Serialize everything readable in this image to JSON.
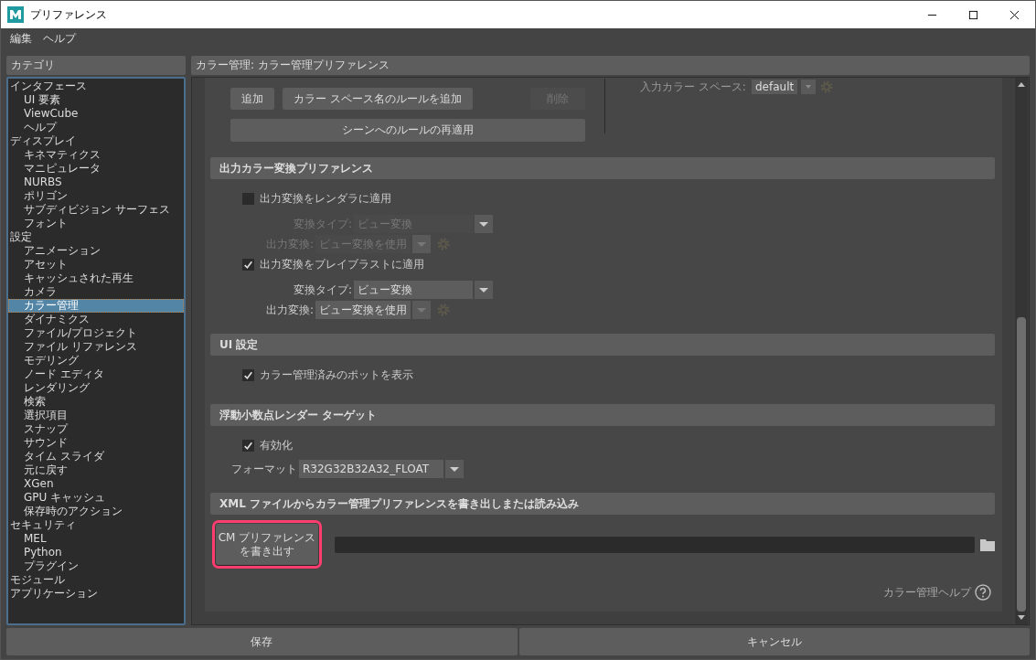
{
  "window": {
    "title": "プリファレンス"
  },
  "menu": [
    "編集",
    "ヘルプ"
  ],
  "categories": {
    "header": "カテゴリ",
    "items": [
      {
        "label": "インタフェース",
        "selected": false,
        "children": [
          {
            "label": "UI 要素",
            "selected": false
          },
          {
            "label": "ViewCube",
            "selected": false
          },
          {
            "label": "ヘルプ",
            "selected": false
          }
        ]
      },
      {
        "label": "ディスプレイ",
        "selected": false,
        "children": [
          {
            "label": "キネマティクス",
            "selected": false
          },
          {
            "label": "マニピュレータ",
            "selected": false
          },
          {
            "label": "NURBS",
            "selected": false
          },
          {
            "label": "ポリゴン",
            "selected": false
          },
          {
            "label": "サブディビジョン サーフェス",
            "selected": false
          },
          {
            "label": "フォント",
            "selected": false
          }
        ]
      },
      {
        "label": "設定",
        "selected": false,
        "children": [
          {
            "label": "アニメーション",
            "selected": false
          },
          {
            "label": "アセット",
            "selected": false
          },
          {
            "label": "キャッシュされた再生",
            "selected": false
          },
          {
            "label": "カメラ",
            "selected": false
          },
          {
            "label": "カラー管理",
            "selected": true
          },
          {
            "label": "ダイナミクス",
            "selected": false
          },
          {
            "label": "ファイル/プロジェクト",
            "selected": false
          },
          {
            "label": "ファイル リファレンス",
            "selected": false
          },
          {
            "label": "モデリング",
            "selected": false
          },
          {
            "label": "ノード エディタ",
            "selected": false
          },
          {
            "label": "レンダリング",
            "selected": false
          },
          {
            "label": "検索",
            "selected": false
          },
          {
            "label": "選択項目",
            "selected": false
          },
          {
            "label": "スナップ",
            "selected": false
          },
          {
            "label": "サウンド",
            "selected": false
          },
          {
            "label": "タイム スライダ",
            "selected": false
          },
          {
            "label": "元に戻す",
            "selected": false
          },
          {
            "label": "XGen",
            "selected": false
          },
          {
            "label": "GPU キャッシュ",
            "selected": false
          },
          {
            "label": "保存時のアクション",
            "selected": false
          }
        ]
      },
      {
        "label": "セキュリティ",
        "selected": false,
        "children": [
          {
            "label": "MEL",
            "selected": false
          },
          {
            "label": "Python",
            "selected": false
          },
          {
            "label": "プラグイン",
            "selected": false
          }
        ]
      },
      {
        "label": "モジュール",
        "selected": false
      },
      {
        "label": "アプリケーション",
        "selected": false
      }
    ]
  },
  "panel": {
    "header": "カラー管理: カラー管理プリファレンス",
    "rules": {
      "buttons": [
        {
          "label": "追加",
          "disabled": false
        },
        {
          "label": "カラー スペース名のルールを追加",
          "disabled": false
        },
        {
          "label": "削除",
          "disabled": true
        }
      ],
      "reapply": "シーンへのルールの再適用",
      "input_space": {
        "label": "入力カラー スペース:",
        "value": "default",
        "disabled": true
      }
    },
    "sections": [
      {
        "title": "出力カラー変換プリファレンス",
        "rows": [
          {
            "kind": "checkbox",
            "label": "出力変換をレンダラに適用",
            "checked": false
          },
          {
            "kind": "dropdown",
            "label": "変換タイプ:",
            "value": "ビュー変換",
            "disabled": true,
            "gear": false
          },
          {
            "kind": "dropdown",
            "label": "出力変換:",
            "value": "ビュー変換を使用",
            "disabled": true,
            "gear": true
          },
          {
            "kind": "checkbox",
            "label": "出力変換をプレイブラストに適用",
            "checked": true
          },
          {
            "kind": "dropdown",
            "label": "変換タイプ:",
            "value": "ビュー変換",
            "disabled": false,
            "gear": false
          },
          {
            "kind": "dropdown",
            "label": "出力変換:",
            "value": "ビュー変換を使用",
            "disabled": false,
            "gear": true
          }
        ]
      },
      {
        "title": "UI 設定",
        "rows": [
          {
            "kind": "checkbox",
            "label": "カラー管理済みのポットを表示",
            "checked": true
          }
        ]
      },
      {
        "title": "浮動小数点レンダー ターゲット",
        "rows": [
          {
            "kind": "checkbox",
            "label": "有効化",
            "checked": true
          },
          {
            "kind": "dropdown",
            "label": "フォーマット",
            "value": "R32G32B32A32_FLOAT",
            "disabled": false,
            "gear": false
          }
        ]
      },
      {
        "title": "XML ファイルからカラー管理プリファレンスを書き出しまたは読み込み",
        "rows": [
          {
            "kind": "export",
            "button": "CM プリファレンスを書き出す",
            "highlighted": true
          }
        ]
      }
    ],
    "help": "カラー管理ヘルプ"
  },
  "footer": [
    "保存",
    "キャンセル"
  ]
}
